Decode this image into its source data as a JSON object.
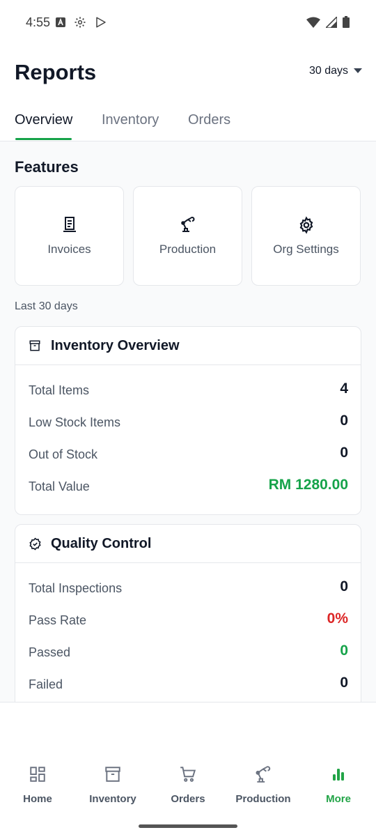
{
  "status": {
    "time": "4:55"
  },
  "header": {
    "title": "Reports",
    "range": "30 days"
  },
  "tabs": [
    {
      "label": "Overview",
      "active": true
    },
    {
      "label": "Inventory",
      "active": false
    },
    {
      "label": "Orders",
      "active": false
    }
  ],
  "features": {
    "title": "Features",
    "items": [
      {
        "label": "Invoices",
        "icon": "receipt-icon"
      },
      {
        "label": "Production",
        "icon": "robot-arm-icon"
      },
      {
        "label": "Org Settings",
        "icon": "gear-icon"
      }
    ]
  },
  "period_label": "Last 30 days",
  "inventory_overview": {
    "title": "Inventory Overview",
    "rows": [
      {
        "label": "Total Items",
        "value": "4"
      },
      {
        "label": "Low Stock Items",
        "value": "0"
      },
      {
        "label": "Out of Stock",
        "value": "0"
      },
      {
        "label": "Total Value",
        "value": "RM 1280.00"
      }
    ]
  },
  "quality_control": {
    "title": "Quality Control",
    "rows": [
      {
        "label": "Total Inspections",
        "value": "0"
      },
      {
        "label": "Pass Rate",
        "value": "0%"
      },
      {
        "label": "Passed",
        "value": "0"
      },
      {
        "label": "Failed",
        "value": "0"
      }
    ]
  },
  "bottom_nav": [
    {
      "label": "Home",
      "icon": "dashboard-icon",
      "active": false
    },
    {
      "label": "Inventory",
      "icon": "archive-icon",
      "active": false
    },
    {
      "label": "Orders",
      "icon": "cart-icon",
      "active": false
    },
    {
      "label": "Production",
      "icon": "robot-arm-icon",
      "active": false
    },
    {
      "label": "More",
      "icon": "bar-chart-icon",
      "active": true
    }
  ],
  "colors": {
    "accent": "#16a34a",
    "danger": "#dc2626",
    "text": "#111827",
    "muted": "#4b5563"
  }
}
